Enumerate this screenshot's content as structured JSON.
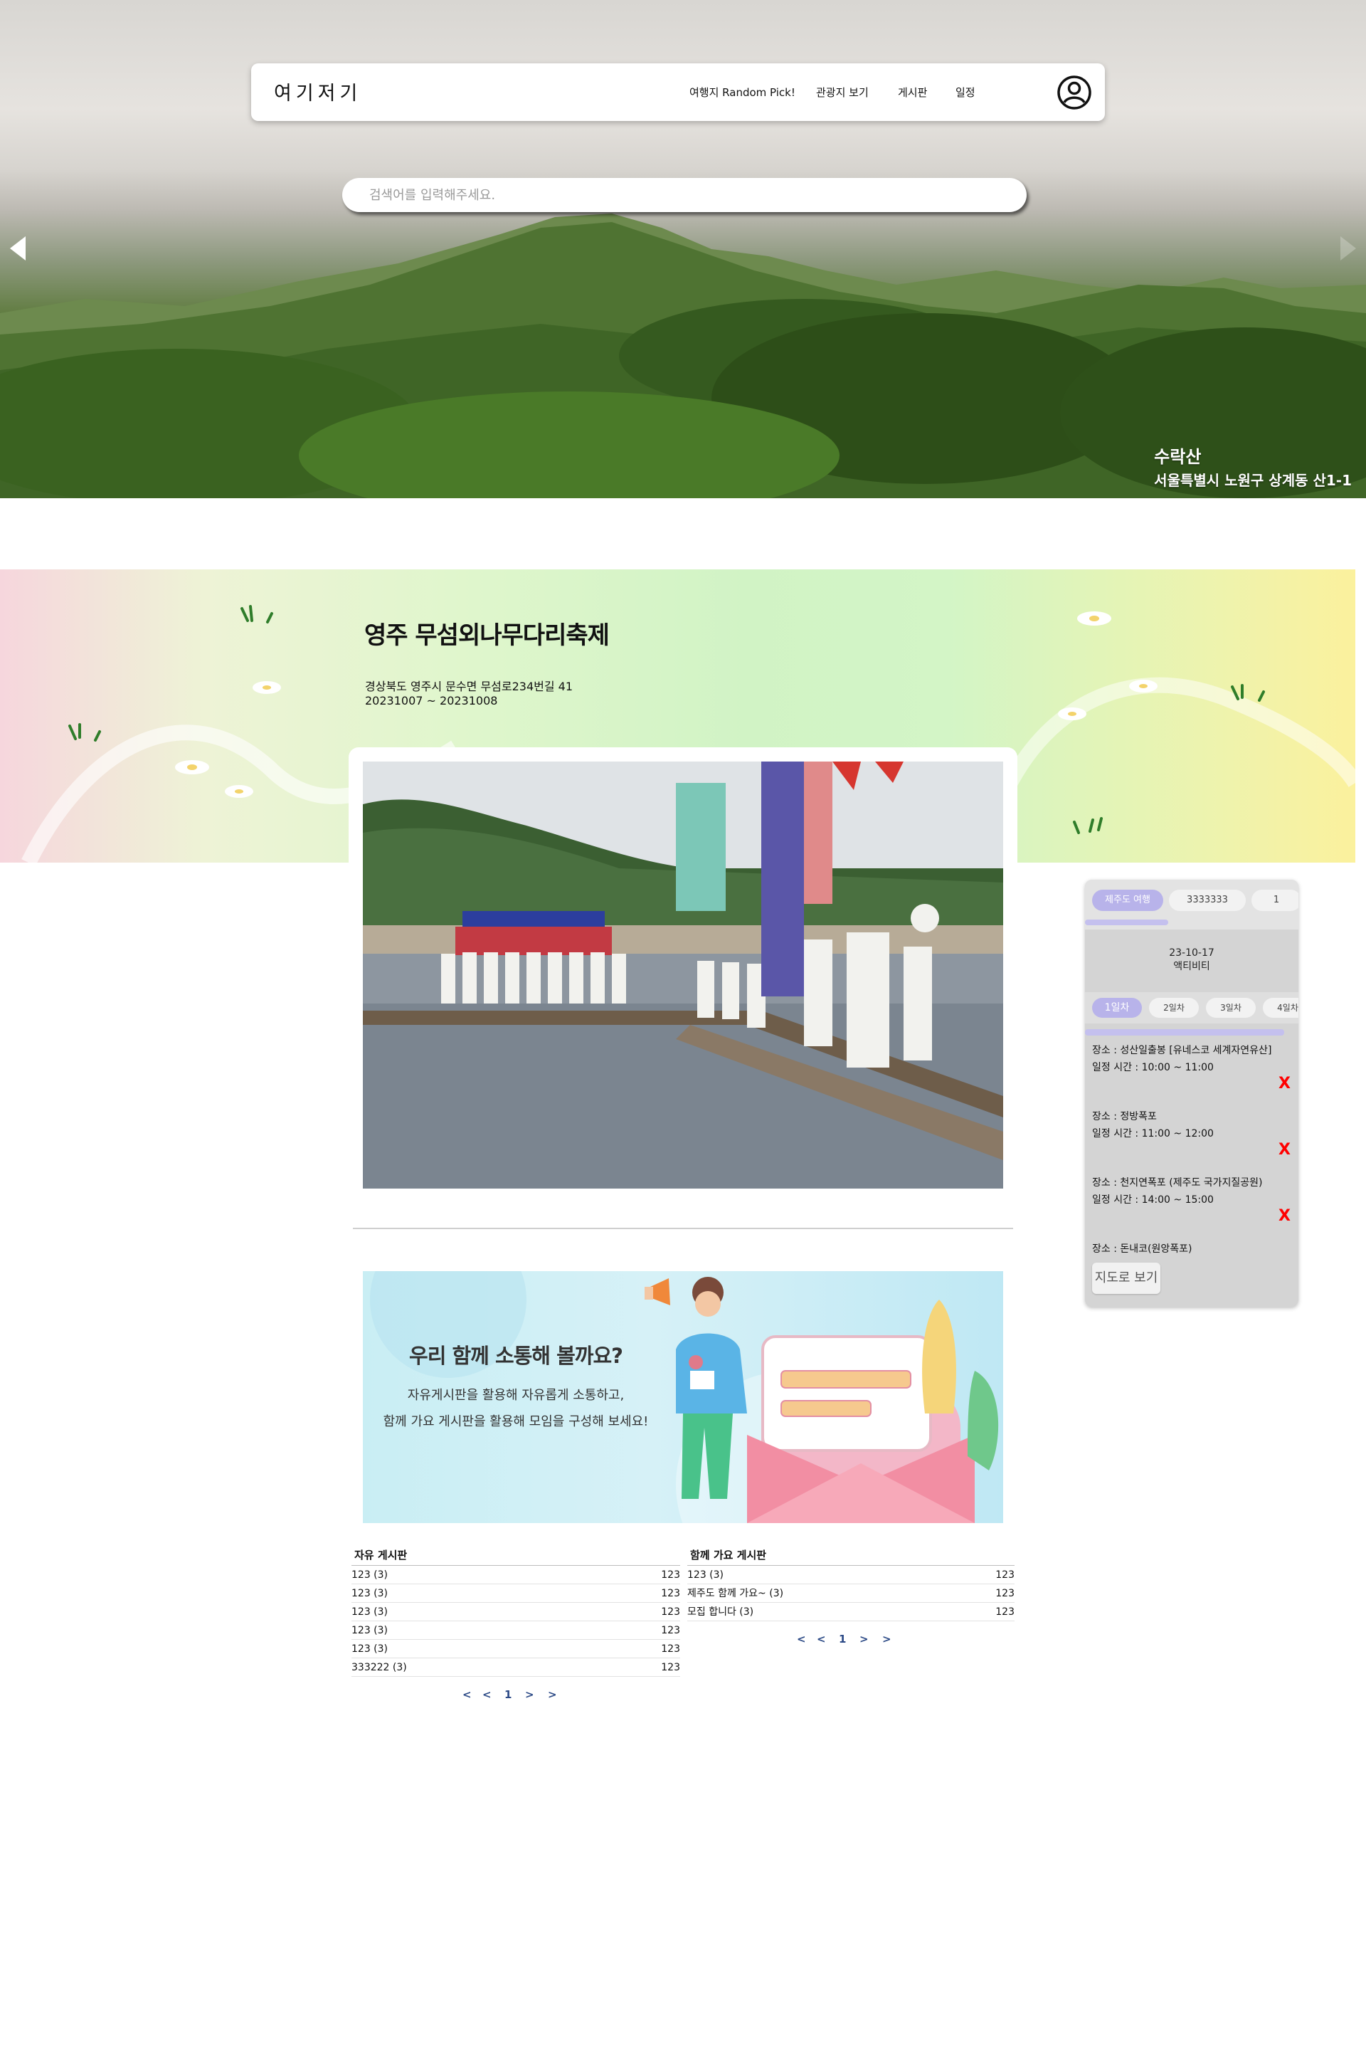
{
  "header": {
    "logo": "여기저기",
    "nav": [
      "여행지 Random Pick!",
      "관광지 보기",
      "게시판",
      "일정"
    ]
  },
  "search": {
    "placeholder": "검색어를 입력해주세요."
  },
  "hero": {
    "place_name": "수락산",
    "place_address": "서울특별시 노원구 상계동 산1-1"
  },
  "festival": {
    "title": "영주 무섬외나무다리축제",
    "address": "경상북도 영주시 문수면 무섬로234번길 41",
    "date": "20231007 ~ 20231008"
  },
  "community": {
    "title": "우리 함께 소통해 볼까요?",
    "line1": "자유게시판을 활용해 자유롭게 소통하고,",
    "line2": "함께 가요 게시판을 활용해 모임을 구성해 보세요!"
  },
  "free_board": {
    "title": "자유 게시판",
    "rows": [
      {
        "title": "123   (3)",
        "value": "123"
      },
      {
        "title": "123   (3)",
        "value": "123"
      },
      {
        "title": "123   (3)",
        "value": "123"
      },
      {
        "title": "123   (3)",
        "value": "123"
      },
      {
        "title": "123   (3)",
        "value": "123"
      },
      {
        "title": "333222   (3)",
        "value": "123"
      }
    ],
    "pager": [
      "<",
      "<",
      "1",
      ">",
      ">"
    ]
  },
  "together_board": {
    "title": "함께 가요 게시판",
    "rows": [
      {
        "title": "123   (3)",
        "value": "123"
      },
      {
        "title": "제주도 함께 가요~   (3)",
        "value": "123"
      },
      {
        "title": "모집 합니다   (3)",
        "value": "123"
      }
    ],
    "pager": [
      "<",
      "<",
      "1",
      ">",
      ">"
    ]
  },
  "schedule": {
    "trips": [
      "제주도 여행",
      "3333333",
      "1"
    ],
    "date": "23-10-17",
    "subtitle": "액티비티",
    "days": [
      "1일차",
      "2일차",
      "3일차",
      "4일차"
    ],
    "items": [
      {
        "place": "장소 : 성산일출봉 [유네스코 세계자연유산]",
        "time": "일정 시간 : 10:00 ~ 11:00"
      },
      {
        "place": "장소 : 정방폭포",
        "time": "일정 시간 : 11:00 ~ 12:00"
      },
      {
        "place": "장소 : 천지연폭포 (제주도 국가지질공원)",
        "time": "일정 시간 : 14:00 ~ 15:00"
      },
      {
        "place": "장소 : 돈내코(원앙폭포)",
        "time": ""
      }
    ],
    "delete_label": "X",
    "map_button": "지도로 보기"
  },
  "colors": {
    "accent": "#b8b3ea",
    "pager": "#2c4a86",
    "delete": "#ff0000"
  }
}
